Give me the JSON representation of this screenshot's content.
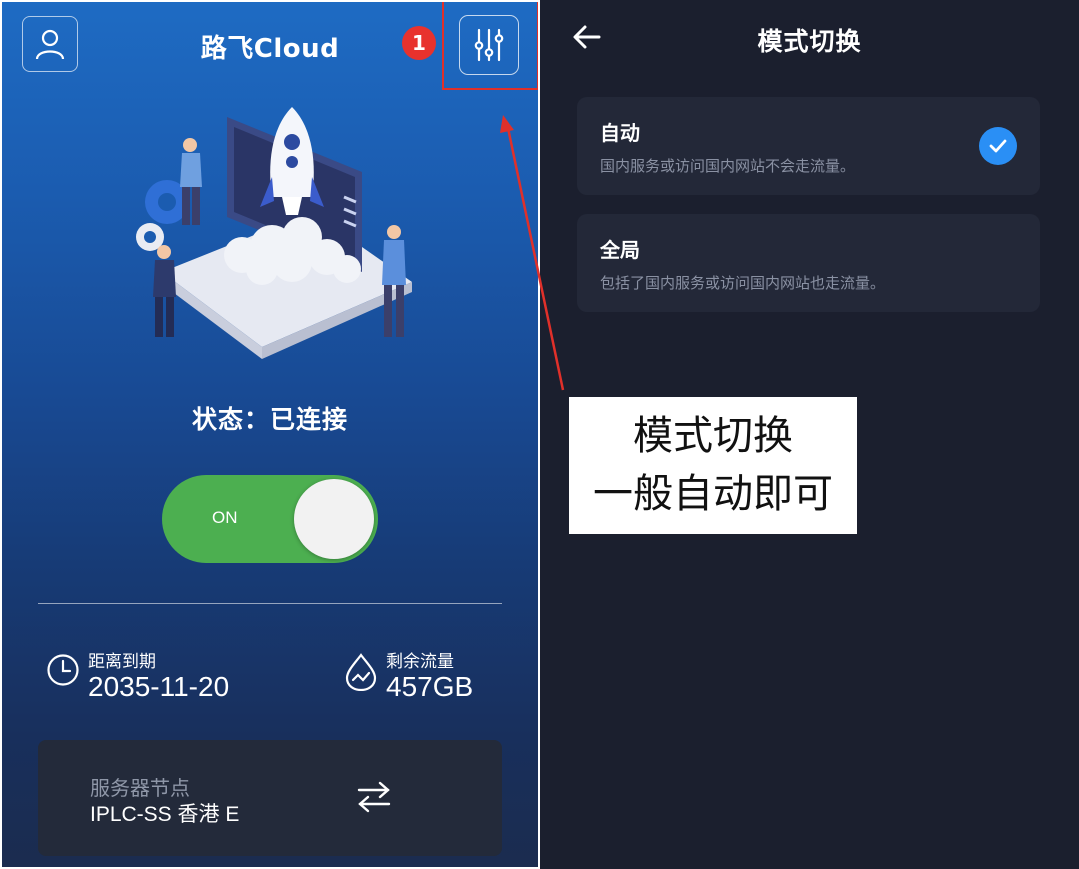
{
  "left": {
    "app_title": "路飞Cloud",
    "step_badge": "1",
    "status_label": "状态",
    "status_sep": "：",
    "status_value": "已连接",
    "toggle_label": "ON",
    "expiry": {
      "label": "距离到期",
      "value": "2035-11-20",
      "icon": "clock-icon"
    },
    "traffic": {
      "label": "剩余流量",
      "value": "457GB",
      "icon": "traffic-icon"
    },
    "node": {
      "label": "服务器节点",
      "name": "IPLC-SS 香港 E"
    }
  },
  "right": {
    "title": "模式切换",
    "options": [
      {
        "title": "自动",
        "desc": "国内服务或访问国内网站不会走流量。",
        "selected": true
      },
      {
        "title": "全局",
        "desc": "包括了国内服务或访问国内网站也走流量。",
        "selected": false
      }
    ]
  },
  "callout": {
    "line1": "模式切换",
    "line2": "一般自动即可"
  },
  "colors": {
    "accent_blue": "#2a8ff5",
    "toggle_green": "#4caf50",
    "annotation_red": "#e0302a",
    "dark_panel": "#1b1f2e"
  }
}
